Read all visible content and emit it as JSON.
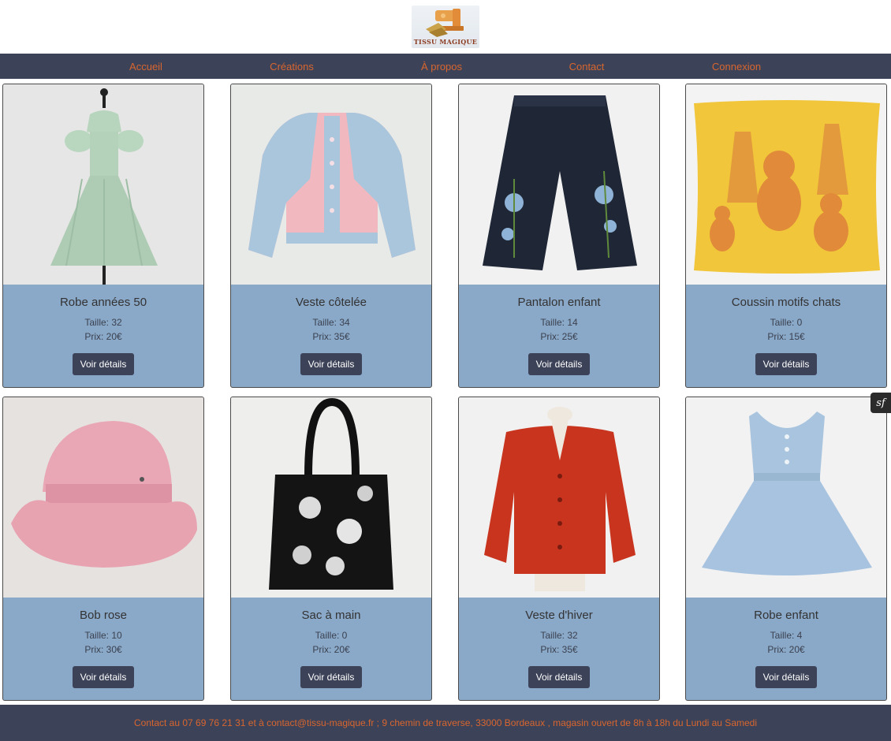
{
  "logo": {
    "text": "TISSU MAGIQUE"
  },
  "nav": [
    {
      "label": "Accueil"
    },
    {
      "label": "Créations"
    },
    {
      "label": "À propos"
    },
    {
      "label": "Contact"
    },
    {
      "label": "Connexion"
    }
  ],
  "products": [
    {
      "title": "Robe années 50",
      "size": "Taille: 32",
      "price": "Prix: 20€",
      "button": "Voir détails",
      "image": "green-dress"
    },
    {
      "title": "Veste côtelée",
      "size": "Taille: 34",
      "price": "Prix: 35€",
      "button": "Voir détails",
      "image": "pink-blue-cardigan"
    },
    {
      "title": "Pantalon enfant",
      "size": "Taille: 14",
      "price": "Prix: 25€",
      "button": "Voir détails",
      "image": "embroidered-jeans"
    },
    {
      "title": "Coussin motifs chats",
      "size": "Taille: 0",
      "price": "Prix: 15€",
      "button": "Voir détails",
      "image": "cat-cushion"
    },
    {
      "title": "Bob rose",
      "size": "Taille: 10",
      "price": "Prix: 30€",
      "button": "Voir détails",
      "image": "pink-bucket-hat"
    },
    {
      "title": "Sac à main",
      "size": "Taille: 0",
      "price": "Prix: 20€",
      "button": "Voir détails",
      "image": "black-floral-tote"
    },
    {
      "title": "Veste d'hiver",
      "size": "Taille: 32",
      "price": "Prix: 35€",
      "button": "Voir détails",
      "image": "red-cardigan"
    },
    {
      "title": "Robe enfant",
      "size": "Taille: 4",
      "price": "Prix: 20€",
      "button": "Voir détails",
      "image": "blue-child-dress"
    }
  ],
  "footer": {
    "text": "Contact au 07 69 76 21 31 et à contact@tissu-magique.fr ; 9 chemin de traverse, 33000 Bordeaux , magasin ouvert de 8h à 18h du Lundi au Samedi"
  },
  "badge": {
    "icon": "symfony-icon",
    "text": "sf"
  }
}
